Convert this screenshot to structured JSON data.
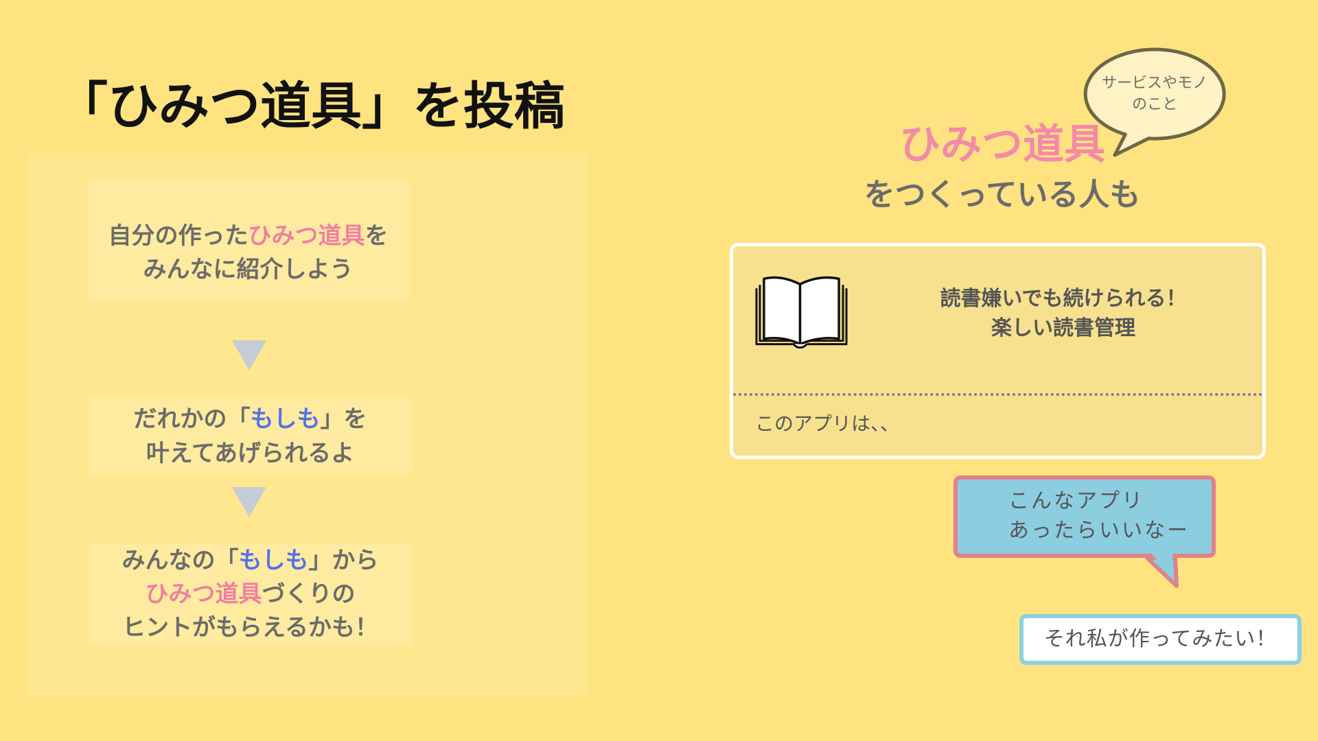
{
  "title": "「ひみつ道具」を投稿",
  "steps": [
    {
      "line1": [
        "自分の作った",
        "ひみつ道具",
        "を"
      ],
      "line2": [
        "みんなに紹介しよう"
      ]
    },
    {
      "line1": [
        "だれかの「",
        "もしも",
        "」を"
      ],
      "line2": [
        "叶えてあげられるよ"
      ]
    },
    {
      "line1": [
        "みんなの「",
        "もしも",
        "」から"
      ],
      "line2": [
        "ひみつ道具",
        "づくりの"
      ],
      "line3": [
        "ヒントがもらえるかも！"
      ]
    }
  ],
  "flow_arrow_icon": "triangle-down-icon",
  "callout": {
    "line1": "サービスやモノ",
    "line2": "のこと"
  },
  "headline": {
    "highlight": "ひみつ道具",
    "rest": "をつくっている人も"
  },
  "app_card": {
    "icon": "book-icon",
    "title_line1": "読書嫌いでも続けられる！",
    "title_line2": "楽しい読書管理",
    "description": "このアプリは、、"
  },
  "wish_bubble": {
    "line1": "こんなアプリ",
    "line2": "あったらいいなー"
  },
  "reply": {
    "text": "それ私が作ってみたい！"
  },
  "colors": {
    "background": "#FFE381",
    "panel": "#FFE78F",
    "step_box": "#FFEB9F",
    "arrow": "#C6CCD5",
    "title": "#111111",
    "text_gray": "#6B6B6B",
    "dark_text": "#555555",
    "pink": "#F07FA2",
    "headline_pink": "#F38AA8",
    "blue": "#5272EC",
    "card_fill": "#F7E18F",
    "card_border": "#FFFFFF",
    "divider": "#7C7C7C",
    "callout_fill": "#FFF2C4",
    "callout_stroke": "#6D6744",
    "wish_fill": "#8DCDE0",
    "wish_border": "#E0828A",
    "reply_border": "#8DCFE2"
  }
}
